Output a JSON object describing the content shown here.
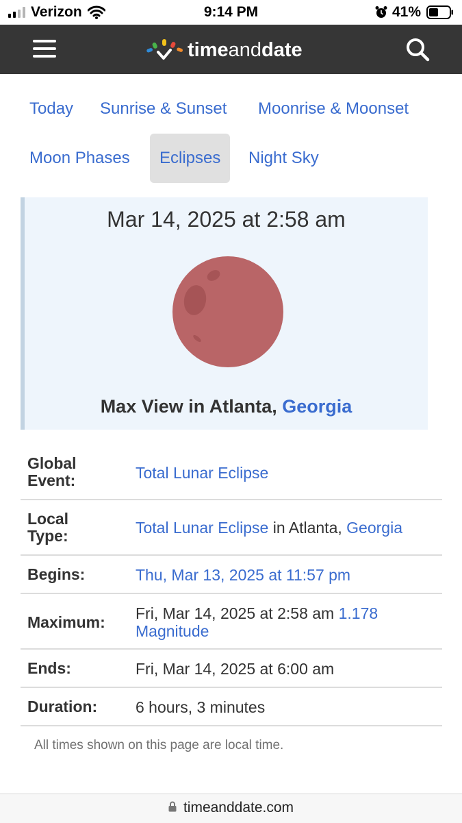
{
  "status_bar": {
    "carrier": "Verizon",
    "time": "9:14 PM",
    "battery": "41%"
  },
  "header": {
    "logo_bold": "time",
    "logo_light": "and",
    "logo_bold2": "date",
    "icons": [
      "menu-icon",
      "search-icon"
    ]
  },
  "tabs": [
    {
      "label": "Today"
    },
    {
      "label": "Sunrise & Sunset"
    },
    {
      "label": "Moonrise & Moonset"
    },
    {
      "label": "Moon Phases"
    },
    {
      "label": "Eclipses",
      "active": true
    },
    {
      "label": "Night Sky"
    }
  ],
  "hero": {
    "date": "Mar 14, 2025 at 2:58 am",
    "caption_prefix": "Max View in Atlanta,",
    "caption_link": "Georgia"
  },
  "details": {
    "global_event": {
      "label_1": "Global",
      "label_2": "Event:",
      "value": "Total Lunar Eclipse"
    },
    "local_type": {
      "label_1": "Local",
      "label_2": "Type:",
      "value_link": "Total Lunar Eclipse",
      "value_mid": "in Atlanta,",
      "value_link2": "Georgia"
    },
    "begins": {
      "label": "Begins:",
      "value": "Thu, Mar 13, 2025 at 11:57 pm"
    },
    "maximum": {
      "label": "Maximum:",
      "value": "Fri, Mar 14, 2025 at 2:58 am",
      "magnitude_value": "1.178",
      "magnitude_label": "Magnitude"
    },
    "ends": {
      "label": "Ends:",
      "value": "Fri, Mar 14, 2025 at 6:00 am"
    },
    "duration": {
      "label": "Duration:",
      "value": "6 hours, 3 minutes"
    }
  },
  "note": "All times shown on this page are local time.",
  "url_bar": {
    "domain": "timeanddate.com"
  },
  "colors": {
    "link": "#3a6ccf",
    "header_bg": "#363636",
    "hero_bg": "#eef5fc",
    "moon": "#b96567"
  }
}
